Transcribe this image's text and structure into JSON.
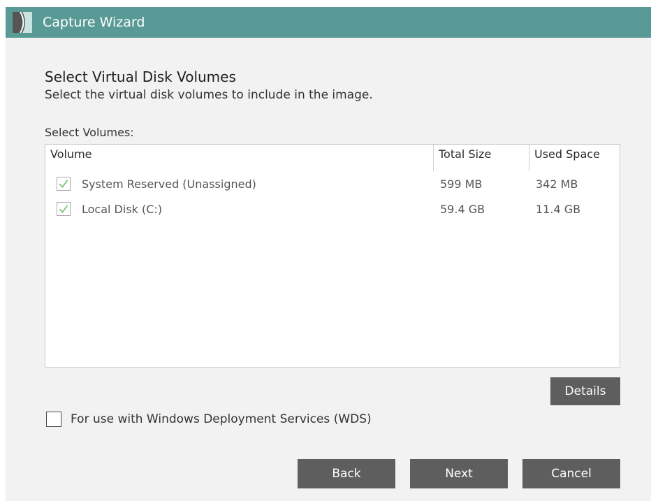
{
  "window": {
    "title": "Capture Wizard",
    "accent_color": "#5a9a96"
  },
  "page": {
    "heading": "Select Virtual Disk Volumes",
    "subheading": "Select the virtual disk volumes to include in the image.",
    "volumes_label": "Select Volumes:"
  },
  "table": {
    "columns": [
      "Volume",
      "Total Size",
      "Used Space"
    ],
    "rows": [
      {
        "checked": true,
        "volume": "System Reserved (Unassigned)",
        "total_size": "599 MB",
        "used_space": "342 MB"
      },
      {
        "checked": true,
        "volume": "Local Disk (C:)",
        "total_size": "59.4 GB",
        "used_space": "11.4 GB"
      }
    ]
  },
  "details_button": "Details",
  "wds_option": {
    "label": "For use with Windows Deployment Services (WDS)",
    "checked": false
  },
  "footer": {
    "back": "Back",
    "next": "Next",
    "cancel": "Cancel"
  },
  "icons": {
    "app": "capture-wizard-logo-icon",
    "check": "checkmark-icon"
  }
}
